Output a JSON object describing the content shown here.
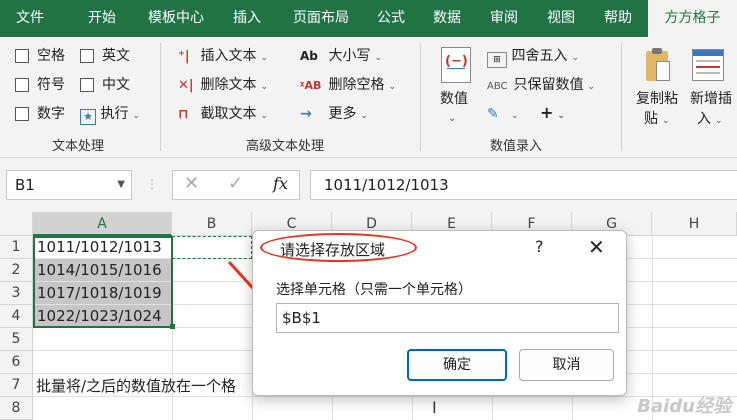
{
  "tabs": [
    {
      "label": "文件",
      "active": false
    },
    {
      "label": "开始",
      "active": false
    },
    {
      "label": "模板中心",
      "active": false
    },
    {
      "label": "插入",
      "active": false
    },
    {
      "label": "页面布局",
      "active": false
    },
    {
      "label": "公式",
      "active": false
    },
    {
      "label": "数据",
      "active": false
    },
    {
      "label": "审阅",
      "active": false
    },
    {
      "label": "视图",
      "active": false
    },
    {
      "label": "帮助",
      "active": false
    },
    {
      "label": "方方格子",
      "active": true
    }
  ],
  "ribbon": {
    "text_group": {
      "label": "文本处理",
      "checkboxes": [
        "空格",
        "英文",
        "符号",
        "中文",
        "数字"
      ],
      "exec": "执行"
    },
    "adv_group": {
      "label": "高级文本处理",
      "insert_text": "插入文本",
      "delete_text": "删除文本",
      "extract_text": "截取文本",
      "case": "大小写",
      "delete_space": "删除空格",
      "more": "更多"
    },
    "num_group": {
      "label": "数值录入",
      "numeric": "数值",
      "round": "四舍五入",
      "keep_numeric": "只保留数值",
      "plus": "+"
    },
    "copy_paste": {
      "line1": "复制粘",
      "line2": "贴"
    },
    "new_insert": {
      "line1": "新增插",
      "line2": "入"
    }
  },
  "formula_bar": {
    "name_box": "B1",
    "fx": "fx",
    "content": "1011/1012/1013"
  },
  "grid": {
    "columns": [
      "A",
      "B",
      "C",
      "D",
      "E",
      "F",
      "G",
      "H"
    ],
    "rows": [
      "1",
      "2",
      "3",
      "4",
      "5",
      "6",
      "7",
      "8"
    ],
    "cells": [
      "1011/1012/1013",
      "1014/1015/1016",
      "1017/1018/1019",
      "1022/1023/1024"
    ],
    "row7_text": "批量将/之后的数值放在一个格"
  },
  "dialog": {
    "title": "请选择存放区域",
    "help": "?",
    "close": "✕",
    "label": "选择单元格（只需一个单元格）",
    "input_value": "$B$1",
    "ok_label": "确定",
    "cancel_label": "取消"
  },
  "watermark": "Baidu经验",
  "colors": {
    "accent": "#217346",
    "annotation": "#e8331f",
    "selection_border": "#217346",
    "dialog_ok_border": "#0067c0"
  }
}
